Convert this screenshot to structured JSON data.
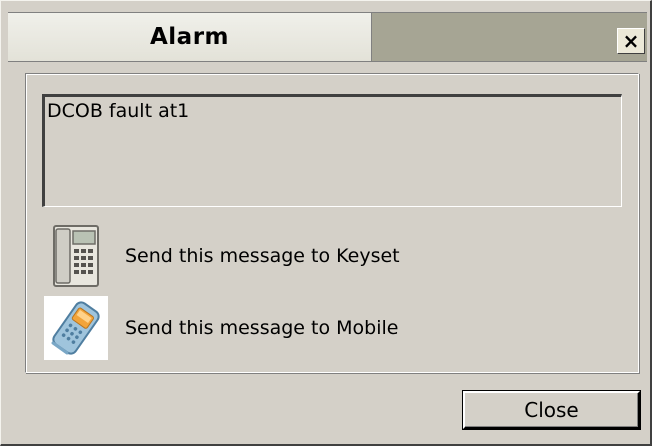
{
  "window": {
    "title": "Alarm",
    "close_glyph": "×"
  },
  "message": {
    "text": "DCOB fault at1"
  },
  "actions": [
    {
      "label": "Send this message to Keyset",
      "icon": "keyset-phone-icon"
    },
    {
      "label": "Send this message to Mobile",
      "icon": "mobile-phone-icon"
    }
  ],
  "footer": {
    "close_label": "Close"
  },
  "colors": {
    "dialog_face": "#d4d0c8",
    "title_tab": "#e3e2d8",
    "title_strip": "#a6a594"
  }
}
